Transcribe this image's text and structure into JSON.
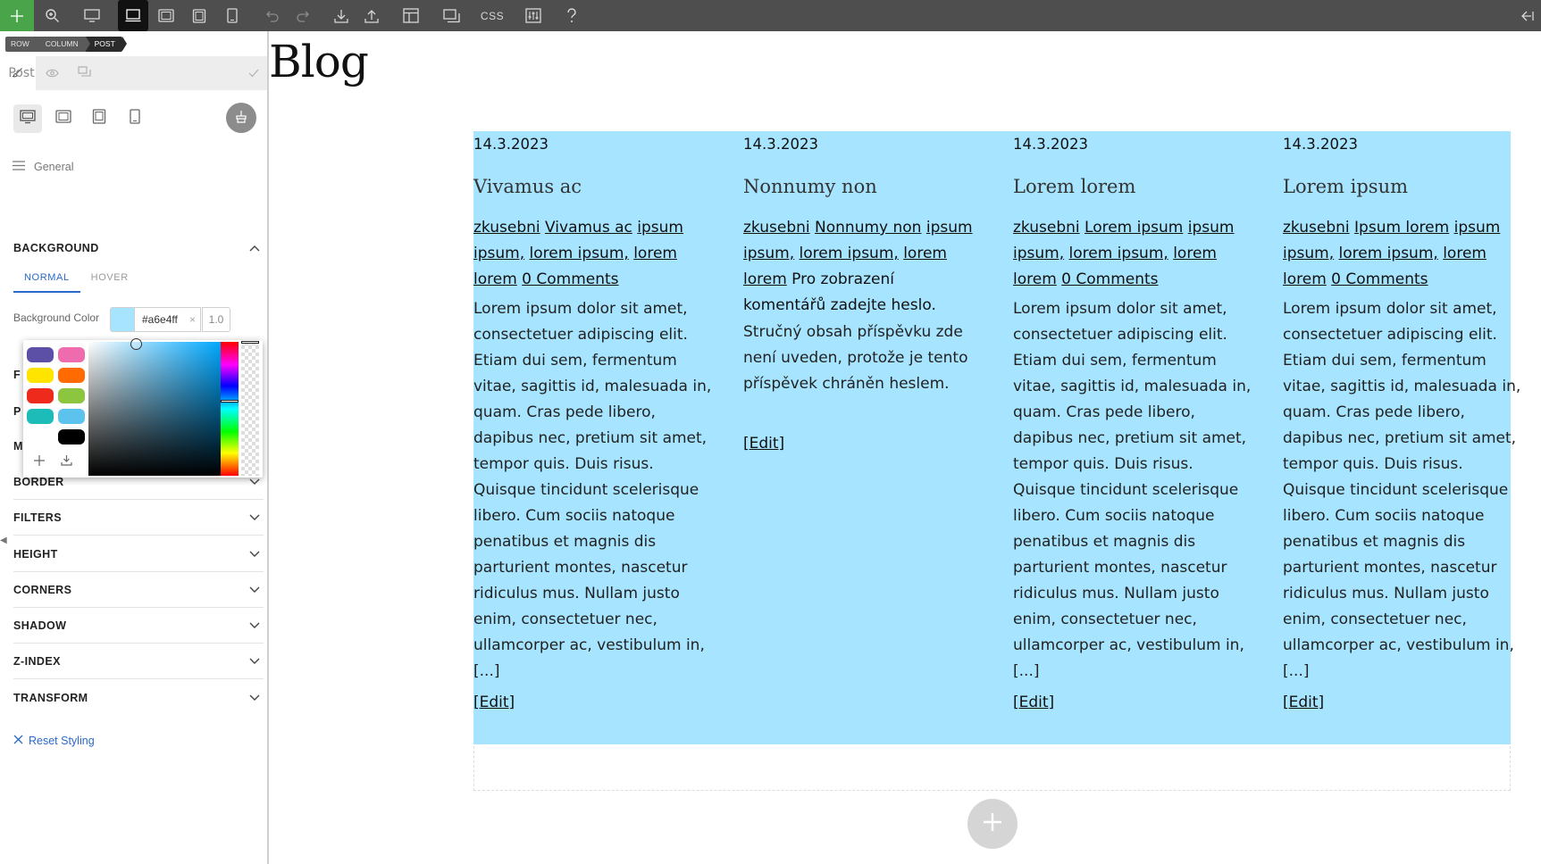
{
  "toolbar": {
    "css_label": "CSS",
    "icons": [
      "plus-icon",
      "zoom-icon",
      "desktop-icon",
      "laptop-icon",
      "tablet-landscape-icon",
      "tablet-portrait-icon",
      "mobile-icon",
      "undo-icon",
      "redo-icon",
      "import-icon",
      "export-icon",
      "layout-icon",
      "window-icon",
      "css-icon",
      "settings-icon",
      "help-icon",
      "back-icon"
    ]
  },
  "panel": {
    "breadcrumb": [
      "ROW",
      "COLUMN",
      "POST"
    ],
    "tab_post": "Post",
    "general_label": "General",
    "background": {
      "title": "BACKGROUND",
      "state_normal": "NORMAL",
      "state_hover": "HOVER",
      "color_label": "Background Color",
      "color_value": "#a6e4ff",
      "hex_text": "#a6e4ff",
      "alpha": "1.0"
    },
    "hidden_sections": [
      "F",
      "P",
      "M"
    ],
    "accordions": [
      "BORDER",
      "FILTERS",
      "HEIGHT",
      "CORNERS",
      "SHADOW",
      "Z-INDEX",
      "TRANSFORM"
    ],
    "reset_label": "Reset Styling"
  },
  "picker": {
    "palette": [
      "#5b50a6",
      "#ee6bae",
      "#ffe400",
      "#ff6b00",
      "#ed2a1b",
      "#8cc63f",
      "#1ebcb8",
      "#5bc3ee",
      "#ffffff",
      "#000000"
    ]
  },
  "canvas": {
    "blog_title": "Blog",
    "container_bg": "#a6e4ff",
    "posts": [
      {
        "date": "14.3.2023",
        "title": "Vivamus ac",
        "meta_lines": [
          [
            "zkusebni",
            "Vivamus ac",
            "ipsum"
          ],
          [
            "ipsum,",
            "lorem ipsum,",
            "lorem"
          ],
          [
            "lorem",
            "0 Comments"
          ]
        ],
        "body": "Lorem ipsum dolor sit amet, consectetuer adipiscing elit. Etiam dui sem, fermentum vitae, sagittis id, malesuada in, quam. Cras pede libero, dapibus nec, pretium sit amet, tempor quis. Duis risus. Quisque tincidunt scelerisque libero. Cum sociis natoque penatibus et magnis dis parturient montes, nascetur ridiculus mus. Nullam justo enim, consectetuer nec, ullamcorper ac, vestibulum in, [...]",
        "edit": "[Edit]"
      },
      {
        "date": "14.3.2023",
        "title": "Nonnumy non",
        "meta_lines": [
          [
            "zkusebni",
            "Nonnumy non",
            "ipsum"
          ],
          [
            "ipsum,",
            "lorem ipsum,",
            "lorem"
          ],
          [
            "lorem"
          ]
        ],
        "meta_tail": "Pro zobrazení komentářů zadejte heslo.",
        "body": "Stručný obsah příspěvku zde není uveden, protože je tento příspěvek chráněn heslem.",
        "edit": "[Edit]"
      },
      {
        "date": "14.3.2023",
        "title": "Lorem lorem",
        "meta_lines": [
          [
            "zkusebni",
            "Lorem ipsum",
            "ipsum"
          ],
          [
            "ipsum,",
            "lorem ipsum,",
            "lorem"
          ],
          [
            "lorem",
            "0 Comments"
          ]
        ],
        "body": "Lorem ipsum dolor sit amet, consectetuer adipiscing elit. Etiam dui sem, fermentum vitae, sagittis id, malesuada in, quam. Cras pede libero, dapibus nec, pretium sit amet, tempor quis. Duis risus. Quisque tincidunt scelerisque libero. Cum sociis natoque penatibus et magnis dis parturient montes, nascetur ridiculus mus. Nullam justo enim, consectetuer nec, ullamcorper ac, vestibulum in, [...]",
        "edit": "[Edit]"
      },
      {
        "date": "14.3.2023",
        "title": "Lorem ipsum",
        "meta_lines": [
          [
            "zkusebni",
            "Ipsum lorem",
            "ipsum"
          ],
          [
            "ipsum,",
            "lorem ipsum,",
            "lorem"
          ],
          [
            "lorem",
            "0 Comments"
          ]
        ],
        "body": "Lorem ipsum dolor sit amet, consectetuer adipiscing elit. Etiam dui sem, fermentum vitae, sagittis id, malesuada in, quam. Cras pede libero, dapibus nec, pretium sit amet, tempor quis. Duis risus. Quisque tincidunt scelerisque libero. Cum sociis natoque penatibus et magnis dis parturient montes, nascetur ridiculus mus. Nullam justo enim, consectetuer nec, ullamcorper ac, vestibulum in, [...]",
        "edit": "[Edit]"
      }
    ]
  }
}
